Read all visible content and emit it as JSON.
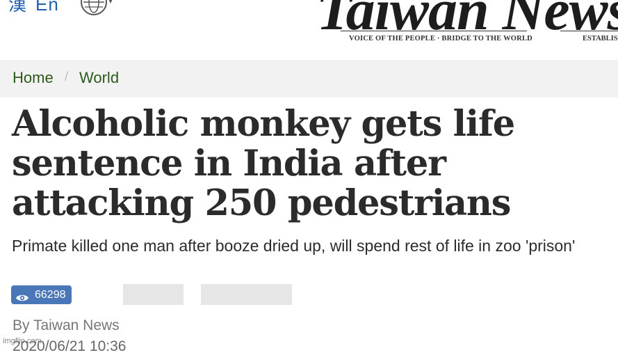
{
  "header": {
    "lang_zh": "漢",
    "lang_en": "En",
    "masthead": "Taiwan News",
    "tagline": "VOICE OF THE PEOPLE · BRIDGE TO THE WORLD",
    "established": "ESTABLIS"
  },
  "breadcrumb": {
    "home": "Home",
    "separator": "/",
    "section": "World"
  },
  "article": {
    "headline": "Alcoholic monkey gets life sentence in India after attacking 250 pedestrians",
    "subhead": "Primate killed one man after booze dried up, will spend rest of life in zoo 'prison'",
    "views": "66298",
    "byline": "By Taiwan News",
    "date": "2020/06/21 10:36"
  },
  "watermark": "imgflip.com",
  "colors": {
    "link_green": "#2b5a1a",
    "badge_blue": "#4a77b8",
    "lang_blue": "#1f5fb0"
  },
  "icons": {
    "globe": "globe-icon",
    "views": "eye-icon"
  }
}
